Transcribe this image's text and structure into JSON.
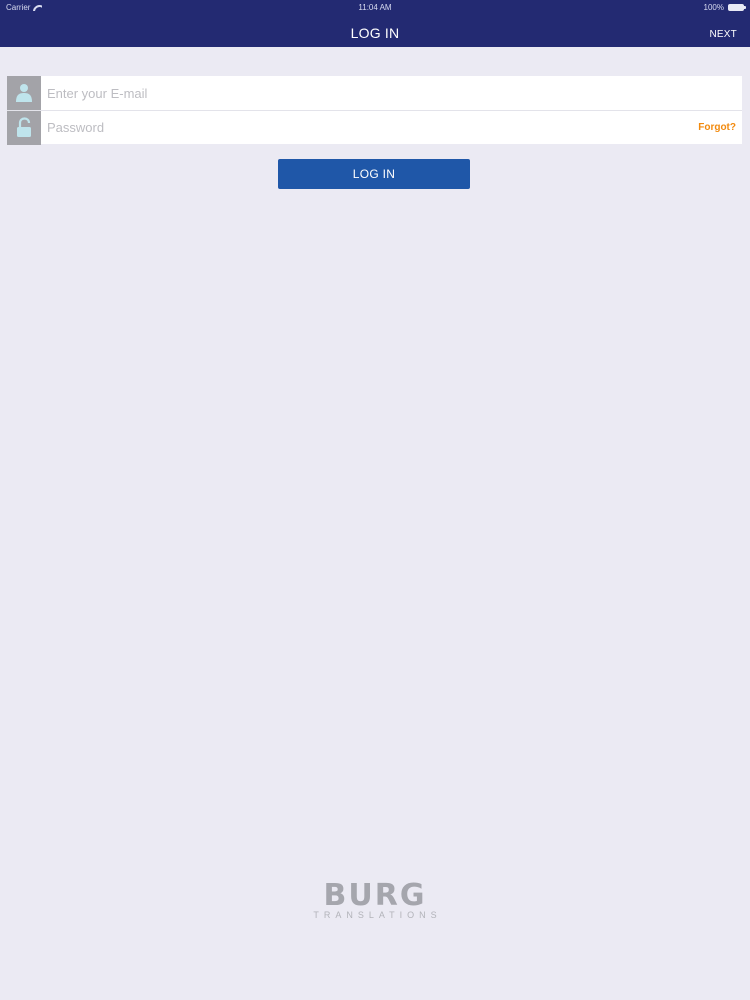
{
  "status_bar": {
    "carrier": "Carrier",
    "time": "11:04 AM",
    "battery": "100%"
  },
  "nav": {
    "title": "LOG IN",
    "next_label": "NEXT"
  },
  "form": {
    "email_placeholder": "Enter your E-mail",
    "email_value": "",
    "password_placeholder": "Password",
    "password_value": "",
    "forgot_label": "Forgot?"
  },
  "login_button_label": "LOG IN",
  "logo": {
    "main": "BURG",
    "sub": "TRANSLATIONS"
  },
  "colors": {
    "nav_bar": "#232A72",
    "background": "#EBEAF3",
    "button": "#1F57A8",
    "forgot": "#F28A0E",
    "icon_box": "#A3A3A8"
  },
  "icons": {
    "email": "user-icon",
    "password": "unlocked-padlock-icon",
    "wifi": "wifi-icon",
    "battery": "battery-icon"
  }
}
